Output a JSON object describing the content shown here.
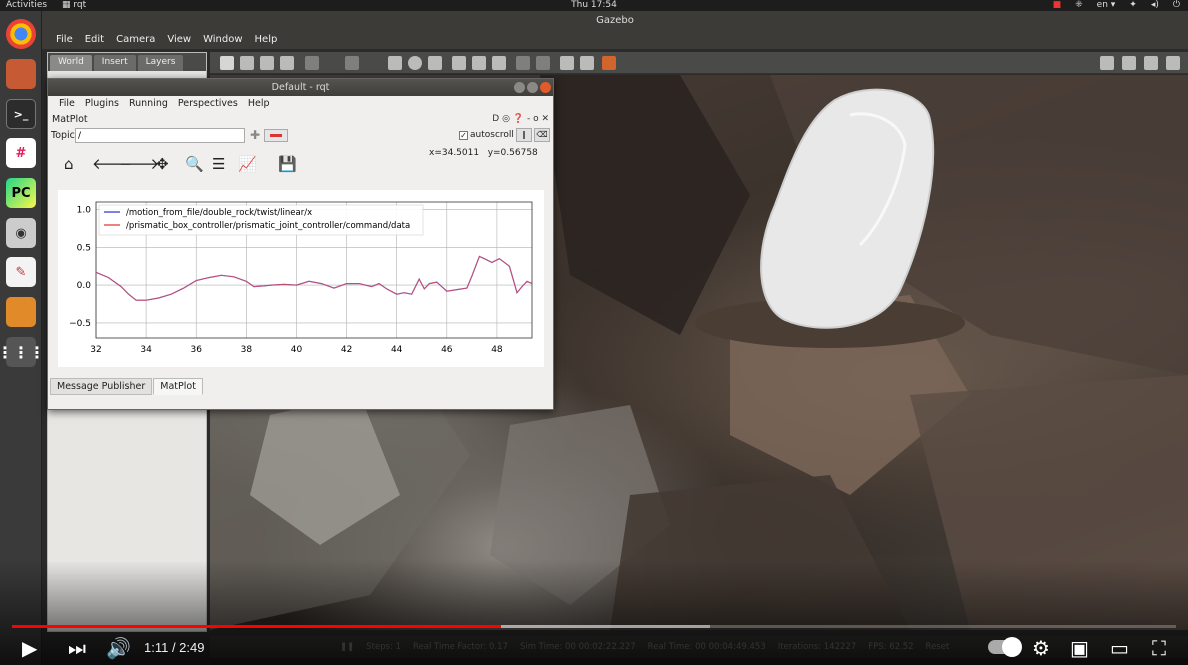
{
  "topbar": {
    "activities": "Activities",
    "app_name": "rqt",
    "clock": "Thu 17:54",
    "lang": "en"
  },
  "gazebo": {
    "title": "Gazebo",
    "menu": [
      "File",
      "Edit",
      "Camera",
      "View",
      "Window",
      "Help"
    ],
    "tabs": [
      "World",
      "Insert",
      "Layers"
    ],
    "status": {
      "steps_label": "Steps:",
      "steps_value": "1",
      "rtf_label": "Real Time Factor:",
      "rtf_value": "0.17",
      "sim_label": "Sim Time:",
      "sim_value": "00 00:02:22.227",
      "real_label": "Real Time:",
      "real_value": "00 00:04:49.453",
      "iter_label": "Iterations:",
      "iter_value": "142227",
      "fps_label": "FPS:",
      "fps_value": "62.52",
      "reset_label": "Reset"
    }
  },
  "rqt": {
    "title": "Default - rqt",
    "menu": [
      "File",
      "Plugins",
      "Running",
      "Perspectives",
      "Help"
    ],
    "plugin_title": "MatPlot",
    "topic_label": "Topic",
    "topic_value": "/",
    "autoscroll_label": "autoscroll",
    "autoscroll_checked": "✓",
    "coord_x": "x=34.5011",
    "coord_y": "y=0.56758",
    "tabs": [
      "Message Publisher",
      "MatPlot"
    ]
  },
  "chart_data": {
    "type": "line",
    "xlim": [
      32,
      49.4
    ],
    "ylim": [
      -0.7,
      1.1
    ],
    "xticks": [
      "32",
      "34",
      "36",
      "38",
      "40",
      "42",
      "44",
      "46",
      "48"
    ],
    "yticks": [
      "1.0",
      "0.5",
      "0.0",
      "−0.5"
    ],
    "grid": true,
    "legend_position": "top-left",
    "series": [
      {
        "name": "/motion_from_file/double_rock/twist/linear/x",
        "color": "#4b4bd9",
        "x": [
          32.0,
          32.5,
          33.0,
          33.3,
          33.6,
          34.0,
          34.5,
          35.0,
          35.5,
          36.0,
          36.5,
          37.0,
          37.5,
          38.0,
          38.3,
          38.7,
          39.0,
          39.5,
          40.0,
          40.5,
          41.0,
          41.5,
          42.0,
          42.5,
          43.0,
          43.3,
          43.6,
          44.0,
          44.3,
          44.6,
          44.9,
          45.1,
          45.3,
          45.6,
          46.0,
          46.4,
          46.8,
          47.0,
          47.3,
          47.5,
          47.8,
          48.1,
          48.5,
          48.8,
          49.0,
          49.2,
          49.4
        ],
        "y": [
          0.17,
          0.1,
          -0.02,
          -0.12,
          -0.2,
          -0.2,
          -0.17,
          -0.12,
          -0.04,
          0.06,
          0.1,
          0.13,
          0.11,
          0.05,
          -0.02,
          -0.01,
          0.0,
          0.01,
          0.0,
          0.05,
          0.02,
          -0.04,
          0.02,
          0.02,
          -0.02,
          0.02,
          -0.05,
          -0.12,
          -0.1,
          -0.12,
          0.08,
          -0.05,
          0.02,
          0.04,
          -0.08,
          -0.06,
          -0.04,
          0.12,
          0.38,
          0.35,
          0.3,
          0.35,
          0.25,
          -0.1,
          -0.02,
          0.05,
          0.02
        ]
      },
      {
        "name": "/prismatic_box_controller/prismatic_joint_controller/command/data",
        "color": "#e84a4a",
        "x": [
          32.0,
          32.5,
          33.0,
          33.3,
          33.6,
          34.0,
          34.5,
          35.0,
          35.5,
          36.0,
          36.5,
          37.0,
          37.5,
          38.0,
          38.3,
          38.7,
          39.0,
          39.5,
          40.0,
          40.5,
          41.0,
          41.5,
          42.0,
          42.5,
          43.0,
          43.3,
          43.6,
          44.0,
          44.3,
          44.6,
          44.9,
          45.1,
          45.3,
          45.6,
          46.0,
          46.4,
          46.8,
          47.0,
          47.3,
          47.5,
          47.8,
          48.1,
          48.5,
          48.8,
          49.0,
          49.2,
          49.4
        ],
        "y": [
          0.17,
          0.1,
          -0.02,
          -0.12,
          -0.2,
          -0.2,
          -0.17,
          -0.12,
          -0.04,
          0.06,
          0.1,
          0.13,
          0.11,
          0.05,
          -0.02,
          -0.01,
          0.0,
          0.01,
          0.0,
          0.05,
          0.02,
          -0.04,
          0.02,
          0.02,
          -0.02,
          0.02,
          -0.05,
          -0.12,
          -0.1,
          -0.12,
          0.08,
          -0.05,
          0.02,
          0.04,
          -0.08,
          -0.06,
          -0.04,
          0.12,
          0.38,
          0.35,
          0.3,
          0.35,
          0.25,
          -0.1,
          -0.02,
          0.05,
          0.02
        ]
      }
    ]
  },
  "youtube": {
    "time": "1:11 / 2:49",
    "played_fraction": 0.42,
    "loaded_fraction": 0.6
  }
}
